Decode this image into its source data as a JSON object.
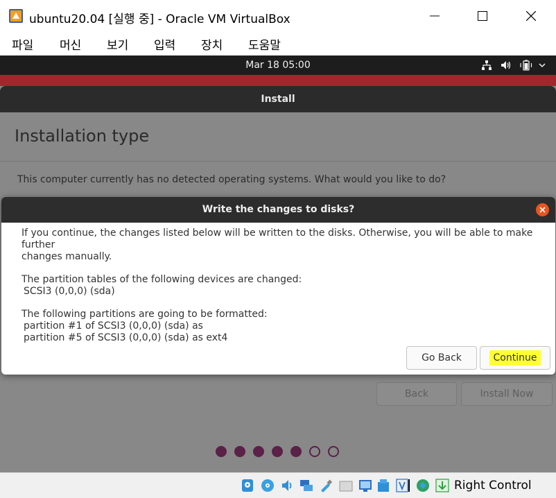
{
  "window": {
    "title": "ubuntu20.04 [실행 중] - Oracle VM VirtualBox",
    "controls": [
      "minimize-icon",
      "maximize-icon",
      "close-icon"
    ]
  },
  "menu": {
    "items": [
      "파일",
      "머신",
      "보기",
      "입력",
      "장치",
      "도움말"
    ]
  },
  "guest_panel": {
    "clock": "Mar 18  05:00",
    "tray_icons": [
      "network-icon",
      "volume-icon",
      "battery-icon",
      "dropdown-arrow-icon"
    ]
  },
  "installer": {
    "header_title": "Install",
    "page_title": "Installation type",
    "question": "This computer currently has no detected operating systems. What would you like to do?",
    "back_label": "Back",
    "install_now_label": "Install Now",
    "progress": {
      "total_steps": 7,
      "completed_steps": 5
    }
  },
  "dialog": {
    "title": "Write the changes to disks?",
    "line1": "If you continue, the changes listed below will be written to the disks. Otherwise, you will be able to make further",
    "line2": "changes manually.",
    "partition_tables_heading": "The partition tables of the following devices are changed:",
    "device": " SCSI3 (0,0,0) (sda)",
    "format_heading": "The following partitions are going to be formatted:",
    "partition1": " partition #1 of SCSI3 (0,0,0) (sda) as",
    "partition5": " partition #5 of SCSI3 (0,0,0) (sda) as ext4",
    "go_back_label": "Go Back",
    "continue_label": "Continue",
    "highlight_color": "#ffff33"
  },
  "colors": {
    "ubuntu_orange": "#e95420",
    "ubuntu_aubergine": "#5b2148",
    "wallpaper_red": "#a3262c"
  },
  "statusbar": {
    "icons": [
      "hard-disk-icon",
      "optical-drive-icon",
      "audio-icon",
      "network-adapter-icon",
      "usb-icon",
      "shared-folders-icon",
      "display-icon",
      "video-capture-icon",
      "virtualization-icon",
      "mouse-integration-icon",
      "keyboard-capture-icon",
      "host-key-arrow-icon"
    ],
    "host_key": "Right Control"
  }
}
